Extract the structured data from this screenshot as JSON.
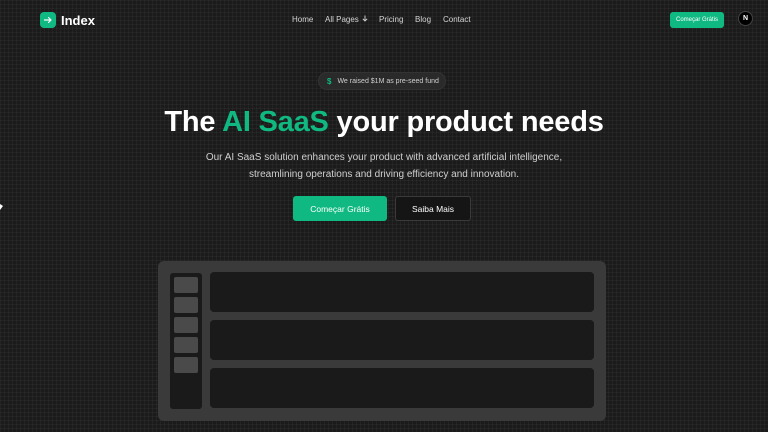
{
  "nav": {
    "logo_text": "Index",
    "menu": {
      "home": "Home",
      "all_pages": "All Pages",
      "pricing": "Pricing",
      "blog": "Blog",
      "contact": "Contact"
    },
    "cta": "Começar Grátis",
    "avatar_letter": "N"
  },
  "badge": {
    "icon": "$",
    "text": "We raised $1M as pre-seed fund"
  },
  "hero": {
    "title_before": "The ",
    "title_accent": "AI SaaS",
    "title_after": " your product needs",
    "subtitle": "Our AI SaaS solution enhances your product with advanced artificial intelligence, streamlining operations and driving efficiency and innovation.",
    "primary_button": "Começar Grátis",
    "secondary_button": "Saiba Mais"
  },
  "colors": {
    "accent": "#10b981",
    "background": "#1b1b1b"
  }
}
